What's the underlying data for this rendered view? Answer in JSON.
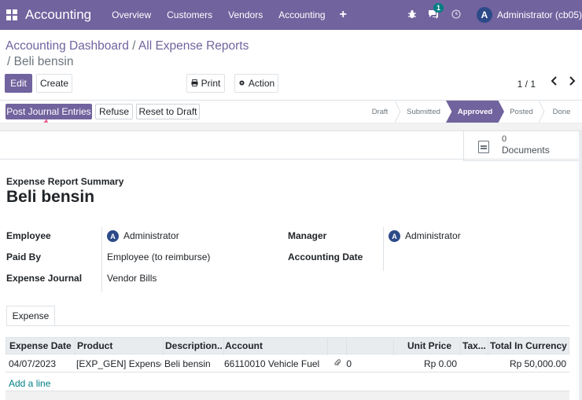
{
  "navbar": {
    "app_title": "Accounting",
    "menu": [
      "Overview",
      "Customers",
      "Vendors",
      "Accounting"
    ],
    "plus_icon": "+",
    "chat_badge": "1",
    "avatar_letter": "A",
    "user": "Administrator (cb05)"
  },
  "control_panel": {
    "breadcrumb": [
      "Accounting Dashboard",
      "All Expense Reports"
    ],
    "active": "/ Beli bensin",
    "edit_label": "Edit",
    "create_label": "Create",
    "print_label": "Print",
    "action_label": "Action",
    "pager": "1 / 1"
  },
  "statusbar": {
    "buttons": [
      "Post Journal Entries",
      "Refuse",
      "Reset to Draft"
    ],
    "stages": [
      "Draft",
      "Submitted",
      "Approved",
      "Posted",
      "Done"
    ],
    "active_stage": "Approved"
  },
  "sheet": {
    "documents_count": "0",
    "documents_label": "Documents",
    "summary_label": "Expense Report Summary",
    "title": "Beli bensin",
    "fields_left": [
      {
        "label": "Employee",
        "value": "Administrator",
        "avatar": "A"
      },
      {
        "label": "Paid By",
        "value": "Employee (to reimburse)"
      },
      {
        "label": "Expense Journal",
        "value": "Vendor Bills"
      }
    ],
    "fields_right": [
      {
        "label": "Manager",
        "value": "Administrator",
        "avatar": "A"
      },
      {
        "label": "Accounting Date",
        "value": ""
      }
    ],
    "tab": "Expense",
    "table": {
      "headers": [
        "Expense Date",
        "Product",
        "Description...",
        "Account",
        "",
        "",
        "Unit Price",
        "Tax...",
        "Total In Currency"
      ],
      "row": {
        "date": "04/07/2023",
        "product": "[EXP_GEN] Expenses",
        "description": "Beli bensin",
        "account": "66110010 Vehicle Fuel",
        "attachments": "0",
        "unit_price": "Rp 0.00",
        "total": "Rp 50,000.00"
      },
      "add_line": "Add a line"
    }
  },
  "colors": {
    "brand": "#71639e",
    "link": "#017e84",
    "avatar": "#2d4a88"
  }
}
